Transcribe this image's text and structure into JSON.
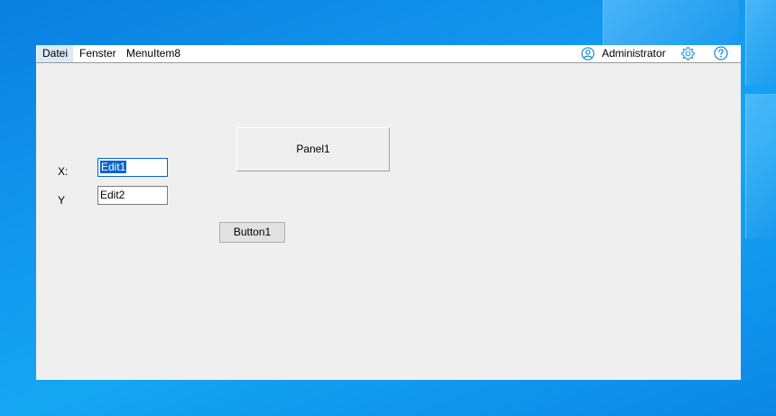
{
  "menu": {
    "items": [
      {
        "label": "Datei"
      },
      {
        "label": "Fenster"
      },
      {
        "label": "MenuItem8"
      }
    ]
  },
  "user": {
    "name": "Administrator",
    "icon": "user-circle-icon"
  },
  "toolbar_icons": {
    "settings": "gear-icon",
    "help": "help-icon"
  },
  "form": {
    "x_label": "X:",
    "y_label": "Y",
    "edit1_value": "Edit1",
    "edit2_value": "Edit2",
    "panel_label": "Panel1",
    "button_label": "Button1"
  },
  "colors": {
    "accent": "#0a64c8",
    "icon": "#1a8fd6",
    "window_bg": "#efefef"
  }
}
